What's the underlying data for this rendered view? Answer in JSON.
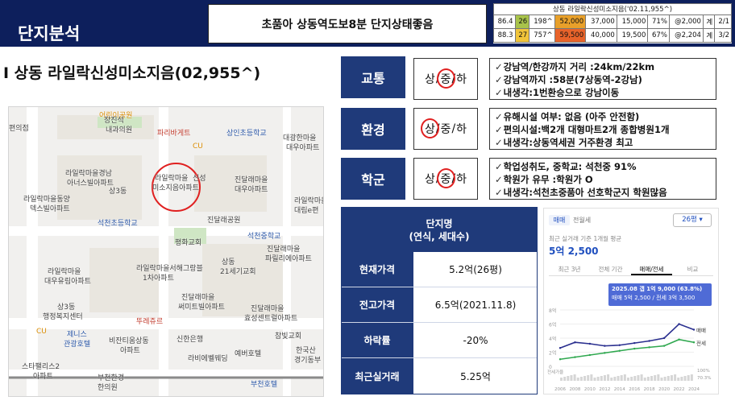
{
  "header": {
    "title": "단지분석",
    "headline": "초품아 상동역도보8분 단지상태좋음",
    "mini_table": {
      "title": "상동 라일락신성미소지음('02.11,955^)",
      "rows": [
        [
          "86.4",
          "26",
          "198^",
          "52,000",
          "37,000",
          "15,000",
          "71%",
          "@2,000",
          "계",
          "2/1"
        ],
        [
          "88.3",
          "27",
          "757^",
          "59,500",
          "40,000",
          "19,500",
          "67%",
          "@2,204",
          "계",
          "3/2"
        ]
      ]
    }
  },
  "subject": "I 상동 라일락신성미소지음(02,955^)",
  "map": {
    "labels": [
      "어린이공원",
      "편의점",
      "장진석",
      "내과의원",
      "파리바게트",
      "CU",
      "상인초등학교",
      "대광한마을",
      "대우아파트",
      "라일락마을경남",
      "아너스빌아파트",
      "라일락마을",
      "신성",
      "미소지음아파트",
      "상3동",
      "진달래마을",
      "대우아파트",
      "라일락마을동양",
      "덱스빌아파트",
      "석천초등학교",
      "진달래공원",
      "석천중학교",
      "평화교회",
      "상동",
      "21세기교회",
      "진달래마을",
      "파릴리에아파트",
      "라일락마을",
      "대우유림아파트",
      "라일락마을서해그랑블",
      "1차아파트",
      "상3동",
      "행정복지센터",
      "뚜레쥬르",
      "진달래마을",
      "써미트빌아파트",
      "진달래마을",
      "효성센트럴아파트",
      "CU",
      "제니스",
      "관광호텔",
      "비잔티움상동",
      "아파트",
      "신한은행",
      "참빛교회",
      "라비에벨웨딩",
      "예버호텔",
      "한국산",
      "경기동부",
      "스타팰리스2",
      "아파트",
      "부천한경",
      "한의원",
      "부천호텔",
      "라일락마을",
      "대림e편"
    ]
  },
  "categories": [
    {
      "label": "교통",
      "grades": [
        "상",
        "중",
        "하"
      ],
      "selected": 1,
      "bullets": [
        "강남역/한강까지 거리 :24km/22km",
        "강남역까지 :58분(7상동역-2강남)",
        "내생각:1번환승으로 강남이동"
      ]
    },
    {
      "label": "환경",
      "grades": [
        "상",
        "중",
        "하"
      ],
      "selected": 0,
      "bullets": [
        "유해시설 여부: 없음 (아주 안전함)",
        "편의시설:백2개 대형마트2개 종합병원1개",
        "내생각:상동역세권 거주환경 최고"
      ]
    },
    {
      "label": "학군",
      "grades": [
        "상",
        "중",
        "하"
      ],
      "selected": 1,
      "bullets": [
        "학업성취도, 중학교: 석천중 91%",
        "학원가 유무 :학원가 O",
        "내생각:석천초중품아 선호학군지 학원많음"
      ]
    }
  ],
  "summary": {
    "head_line1": "단지명",
    "head_line2": "(연식, 세대수)",
    "rows": [
      {
        "key": "현재가격",
        "value": "5.2억(26평)"
      },
      {
        "key": "전고가격",
        "value": "6.5억(2021.11.8)"
      },
      {
        "key": "하락률",
        "value": "-20%"
      },
      {
        "key": "최근실거래",
        "value": "5.25억"
      }
    ]
  },
  "chart_panel": {
    "tab_active": "매매",
    "tab_other": "전월세",
    "dropdown": "26평",
    "subtitle": "최근 실거래 기준 1개월 평균",
    "big_price": "5억 2,500",
    "periods": [
      "최근 3년",
      "전체 기간",
      "매매/전세",
      "비교"
    ],
    "active_period": 2,
    "tooltip_line1": "2025.08  갭 1억 9,000 (63.8%)",
    "tooltip_line2": "매매 5억 2,500 / 전세 3억 3,500",
    "legend_sale": "매매",
    "legend_jeonse": "전세",
    "rate_label": "전세가율",
    "rate_top": "100%",
    "rate_value": "70.3%",
    "accent_sale": "#2a2f8f",
    "accent_jeonse": "#2fa84f"
  },
  "chart_data": {
    "type": "line",
    "x": [
      "2006",
      "2008",
      "2010",
      "2012",
      "2014",
      "2016",
      "2018",
      "2020",
      "2022",
      "2024"
    ],
    "y_ticks": [
      "0",
      "2억",
      "4억",
      "6억",
      "8억"
    ],
    "ylim": [
      0,
      8
    ],
    "series": [
      {
        "name": "매매",
        "values": [
          2.6,
          3.4,
          3.2,
          2.9,
          3.0,
          3.3,
          3.6,
          4.0,
          6.0,
          5.2
        ]
      },
      {
        "name": "전세",
        "values": [
          1.0,
          1.3,
          1.6,
          1.9,
          2.2,
          2.5,
          2.7,
          2.9,
          3.8,
          3.4
        ]
      }
    ]
  }
}
